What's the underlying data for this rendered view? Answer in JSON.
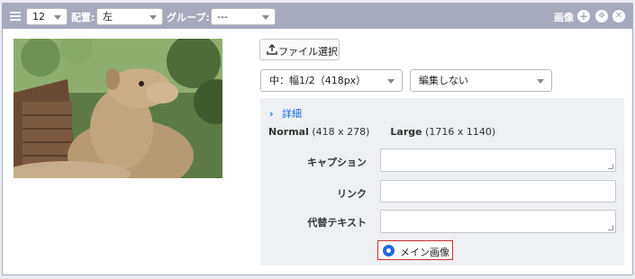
{
  "toolbar": {
    "size_value": "12",
    "align_label": "配置:",
    "align_value": "左",
    "group_label": "グループ:",
    "group_value": "---",
    "type_label": "画像",
    "add_icon": "plus-icon",
    "move_icon": "move-icon",
    "close_icon": "close-icon"
  },
  "image": {
    "alt": "camel photo"
  },
  "controls": {
    "file_button_label": "ファイル選択",
    "width_select_value": "中：幅1/2（418px）",
    "edit_select_value": "編集しない"
  },
  "details": {
    "toggle_label": "詳細",
    "normal_label": "Normal",
    "normal_size": "(418 x 278)",
    "large_label": "Large",
    "large_size": "(1716 x 1140)",
    "caption_label": "キャプション",
    "link_label": "リンク",
    "alt_label": "代替テキスト",
    "caption_value": "",
    "link_value": "",
    "alt_value": "",
    "main_image_label": "メイン画像"
  },
  "colors": {
    "toolbar_bg": "#a7a9bd",
    "accent": "#1e6bd6",
    "highlight_border": "#c9302c"
  }
}
